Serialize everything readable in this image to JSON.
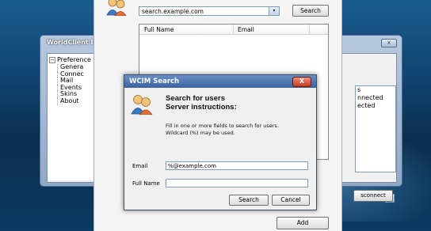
{
  "background_window": {
    "title": "WorldClient I",
    "close_label": "x",
    "tree": {
      "root": "Preference",
      "children": [
        "Genera",
        "Connec",
        "Mail",
        "Events",
        "Skins",
        "About"
      ]
    },
    "status_list": [
      "s",
      "nnected",
      "ected"
    ],
    "scroll_arrow": "▸",
    "disconnect_label": "sconnect"
  },
  "search_window": {
    "server_value": "search.example.com",
    "dropdown_arrow": "▾",
    "search_button": "Search",
    "columns": [
      "Full Name",
      "Email"
    ],
    "add_button": "Add"
  },
  "dialog": {
    "title": "WCIM Search",
    "close_label": "X",
    "heading_line1": "Search for users",
    "heading_line2": "Server instructions:",
    "instruction_line1": "Fill in one or more fields to search for users.",
    "instruction_line2": "Wildcard (%) may be used.",
    "email_label": "Email",
    "email_value": "%@example.com",
    "fullname_label": "Full Name",
    "fullname_value": "",
    "search_button": "Search",
    "cancel_button": "Cancel"
  }
}
